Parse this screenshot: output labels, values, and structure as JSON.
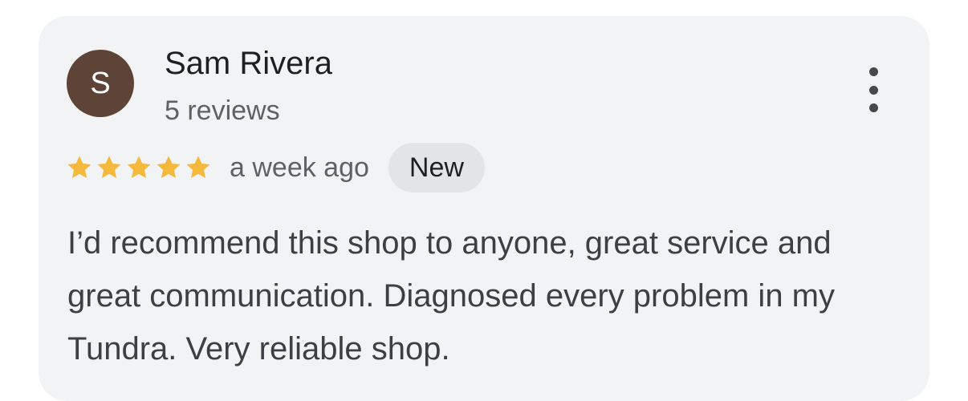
{
  "review": {
    "avatar_initial": "S",
    "avatar_color": "#5d4437",
    "author_name": "Sam Rivera",
    "author_reviews": "5 reviews",
    "rating": 5,
    "rating_max": 5,
    "star_color": "#f4b93c",
    "time_ago": "a week ago",
    "badge": "New",
    "text": "I’d recommend this shop to anyone, great service and great communication. Diagnosed every problem in my Tundra. Very reliable shop.",
    "menu_icon": "more-vert-icon"
  }
}
